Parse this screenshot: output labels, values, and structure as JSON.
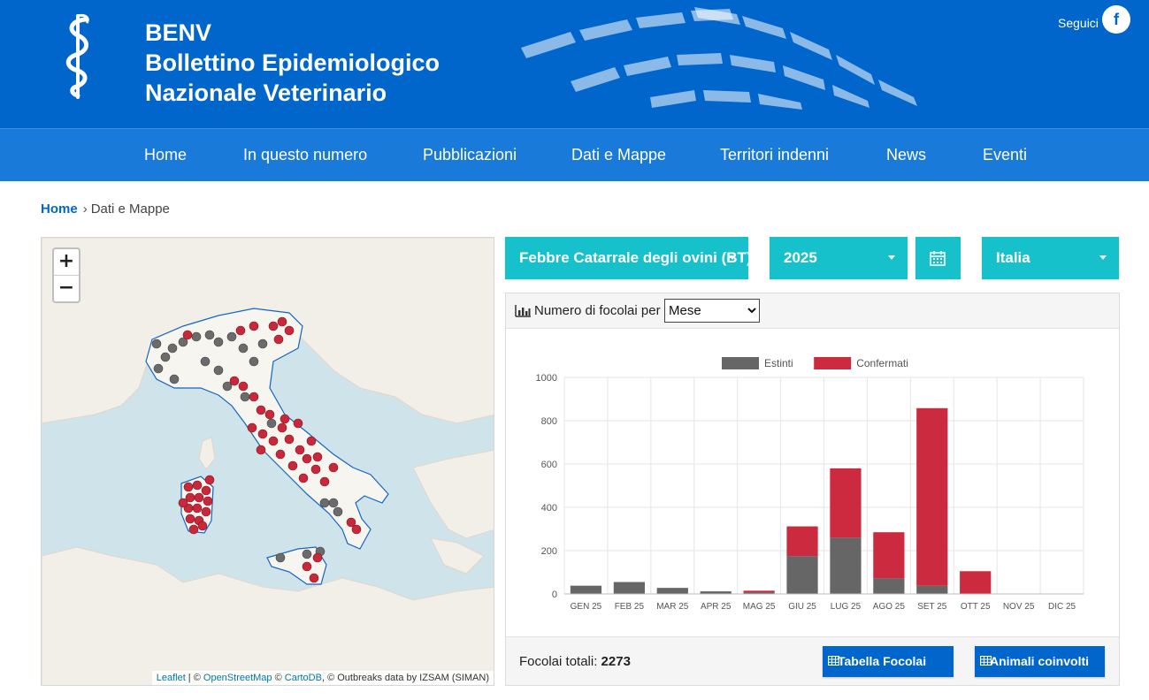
{
  "header": {
    "brand_lines": [
      "BENV",
      "Bollettino Epidemiologico",
      "Nazionale Veterinario"
    ],
    "follow_label": "Seguici",
    "facebook_glyph": "f",
    "colors": {
      "header_bg": "#0066cc",
      "nav_bg": "#1a7ad9"
    }
  },
  "nav": {
    "items": [
      "Home",
      "In questo numero",
      "Pubblicazioni",
      "Dati e Mappe",
      "Territori indenni",
      "News",
      "Eventi"
    ]
  },
  "breadcrumb": {
    "home": "Home",
    "current": "Dati e Mappe"
  },
  "map": {
    "zoom_in": "+",
    "zoom_out": "−",
    "attribution": {
      "leaflet": "Leaflet",
      "sep1": " | © ",
      "osm": "OpenStreetMap",
      "sep2": " © ",
      "carto": "CartoDB",
      "rest": ", © Outbreaks data by IZSAM (SIMAN)"
    },
    "marker_colors": {
      "estinti": "#6b6b6b",
      "confermati": "#c8283a"
    }
  },
  "filters": {
    "disease": "Febbre Catarrale degli ovini (BT)",
    "year": "2025",
    "region": "Italia",
    "calendar_icon": "calendar-icon",
    "accent": "#17c1cb"
  },
  "panel": {
    "title": "Numero di focolai per",
    "group_by": {
      "selected": "Mese",
      "options": [
        "Mese"
      ]
    },
    "total_label": "Focolai totali:",
    "total_value": "2273",
    "buttons": {
      "table": "Tabella Focolai",
      "animals": "Animali coinvolti"
    }
  },
  "chart_data": {
    "type": "bar",
    "stacked": true,
    "categories": [
      "GEN 25",
      "FEB 25",
      "MAR 25",
      "APR 25",
      "MAG 25",
      "GIU 25",
      "LUG 25",
      "AGO 25",
      "SET 25",
      "OTT 25",
      "NOV 25",
      "DIC 25"
    ],
    "series": [
      {
        "name": "Estinti",
        "color": "#666666",
        "values": [
          38,
          55,
          28,
          12,
          8,
          175,
          260,
          72,
          38,
          0,
          0,
          0
        ]
      },
      {
        "name": "Confermati",
        "color": "#cc2b3f",
        "values": [
          0,
          0,
          0,
          0,
          7,
          137,
          320,
          213,
          820,
          105,
          0,
          0
        ]
      }
    ],
    "ylim": [
      0,
      1000
    ],
    "yticks": [
      0,
      200,
      400,
      600,
      800,
      1000
    ],
    "grid": true,
    "legend": "top"
  }
}
